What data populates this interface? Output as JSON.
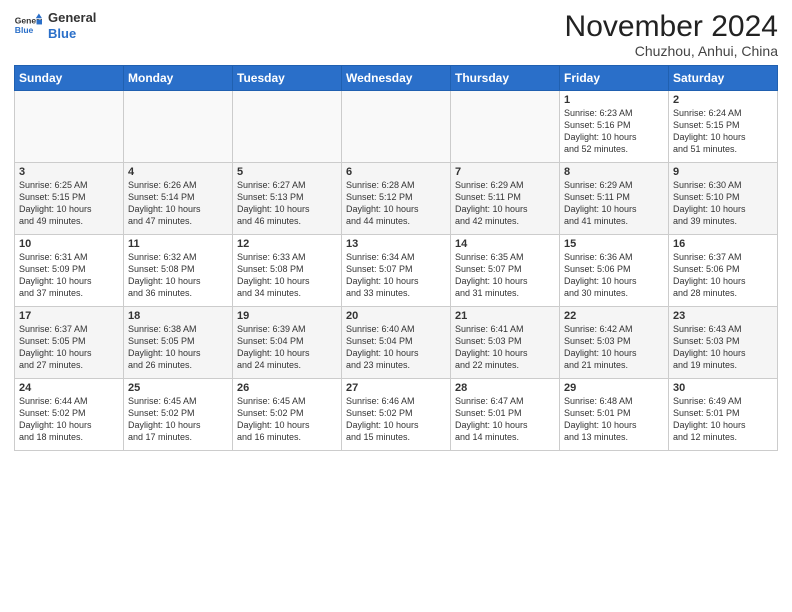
{
  "header": {
    "logo_general": "General",
    "logo_blue": "Blue",
    "month_title": "November 2024",
    "location": "Chuzhou, Anhui, China"
  },
  "days_of_week": [
    "Sunday",
    "Monday",
    "Tuesday",
    "Wednesday",
    "Thursday",
    "Friday",
    "Saturday"
  ],
  "weeks": [
    [
      {
        "day": "",
        "info": ""
      },
      {
        "day": "",
        "info": ""
      },
      {
        "day": "",
        "info": ""
      },
      {
        "day": "",
        "info": ""
      },
      {
        "day": "",
        "info": ""
      },
      {
        "day": "1",
        "info": "Sunrise: 6:23 AM\nSunset: 5:16 PM\nDaylight: 10 hours\nand 52 minutes."
      },
      {
        "day": "2",
        "info": "Sunrise: 6:24 AM\nSunset: 5:15 PM\nDaylight: 10 hours\nand 51 minutes."
      }
    ],
    [
      {
        "day": "3",
        "info": "Sunrise: 6:25 AM\nSunset: 5:15 PM\nDaylight: 10 hours\nand 49 minutes."
      },
      {
        "day": "4",
        "info": "Sunrise: 6:26 AM\nSunset: 5:14 PM\nDaylight: 10 hours\nand 47 minutes."
      },
      {
        "day": "5",
        "info": "Sunrise: 6:27 AM\nSunset: 5:13 PM\nDaylight: 10 hours\nand 46 minutes."
      },
      {
        "day": "6",
        "info": "Sunrise: 6:28 AM\nSunset: 5:12 PM\nDaylight: 10 hours\nand 44 minutes."
      },
      {
        "day": "7",
        "info": "Sunrise: 6:29 AM\nSunset: 5:11 PM\nDaylight: 10 hours\nand 42 minutes."
      },
      {
        "day": "8",
        "info": "Sunrise: 6:29 AM\nSunset: 5:11 PM\nDaylight: 10 hours\nand 41 minutes."
      },
      {
        "day": "9",
        "info": "Sunrise: 6:30 AM\nSunset: 5:10 PM\nDaylight: 10 hours\nand 39 minutes."
      }
    ],
    [
      {
        "day": "10",
        "info": "Sunrise: 6:31 AM\nSunset: 5:09 PM\nDaylight: 10 hours\nand 37 minutes."
      },
      {
        "day": "11",
        "info": "Sunrise: 6:32 AM\nSunset: 5:08 PM\nDaylight: 10 hours\nand 36 minutes."
      },
      {
        "day": "12",
        "info": "Sunrise: 6:33 AM\nSunset: 5:08 PM\nDaylight: 10 hours\nand 34 minutes."
      },
      {
        "day": "13",
        "info": "Sunrise: 6:34 AM\nSunset: 5:07 PM\nDaylight: 10 hours\nand 33 minutes."
      },
      {
        "day": "14",
        "info": "Sunrise: 6:35 AM\nSunset: 5:07 PM\nDaylight: 10 hours\nand 31 minutes."
      },
      {
        "day": "15",
        "info": "Sunrise: 6:36 AM\nSunset: 5:06 PM\nDaylight: 10 hours\nand 30 minutes."
      },
      {
        "day": "16",
        "info": "Sunrise: 6:37 AM\nSunset: 5:06 PM\nDaylight: 10 hours\nand 28 minutes."
      }
    ],
    [
      {
        "day": "17",
        "info": "Sunrise: 6:37 AM\nSunset: 5:05 PM\nDaylight: 10 hours\nand 27 minutes."
      },
      {
        "day": "18",
        "info": "Sunrise: 6:38 AM\nSunset: 5:05 PM\nDaylight: 10 hours\nand 26 minutes."
      },
      {
        "day": "19",
        "info": "Sunrise: 6:39 AM\nSunset: 5:04 PM\nDaylight: 10 hours\nand 24 minutes."
      },
      {
        "day": "20",
        "info": "Sunrise: 6:40 AM\nSunset: 5:04 PM\nDaylight: 10 hours\nand 23 minutes."
      },
      {
        "day": "21",
        "info": "Sunrise: 6:41 AM\nSunset: 5:03 PM\nDaylight: 10 hours\nand 22 minutes."
      },
      {
        "day": "22",
        "info": "Sunrise: 6:42 AM\nSunset: 5:03 PM\nDaylight: 10 hours\nand 21 minutes."
      },
      {
        "day": "23",
        "info": "Sunrise: 6:43 AM\nSunset: 5:03 PM\nDaylight: 10 hours\nand 19 minutes."
      }
    ],
    [
      {
        "day": "24",
        "info": "Sunrise: 6:44 AM\nSunset: 5:02 PM\nDaylight: 10 hours\nand 18 minutes."
      },
      {
        "day": "25",
        "info": "Sunrise: 6:45 AM\nSunset: 5:02 PM\nDaylight: 10 hours\nand 17 minutes."
      },
      {
        "day": "26",
        "info": "Sunrise: 6:45 AM\nSunset: 5:02 PM\nDaylight: 10 hours\nand 16 minutes."
      },
      {
        "day": "27",
        "info": "Sunrise: 6:46 AM\nSunset: 5:02 PM\nDaylight: 10 hours\nand 15 minutes."
      },
      {
        "day": "28",
        "info": "Sunrise: 6:47 AM\nSunset: 5:01 PM\nDaylight: 10 hours\nand 14 minutes."
      },
      {
        "day": "29",
        "info": "Sunrise: 6:48 AM\nSunset: 5:01 PM\nDaylight: 10 hours\nand 13 minutes."
      },
      {
        "day": "30",
        "info": "Sunrise: 6:49 AM\nSunset: 5:01 PM\nDaylight: 10 hours\nand 12 minutes."
      }
    ]
  ]
}
